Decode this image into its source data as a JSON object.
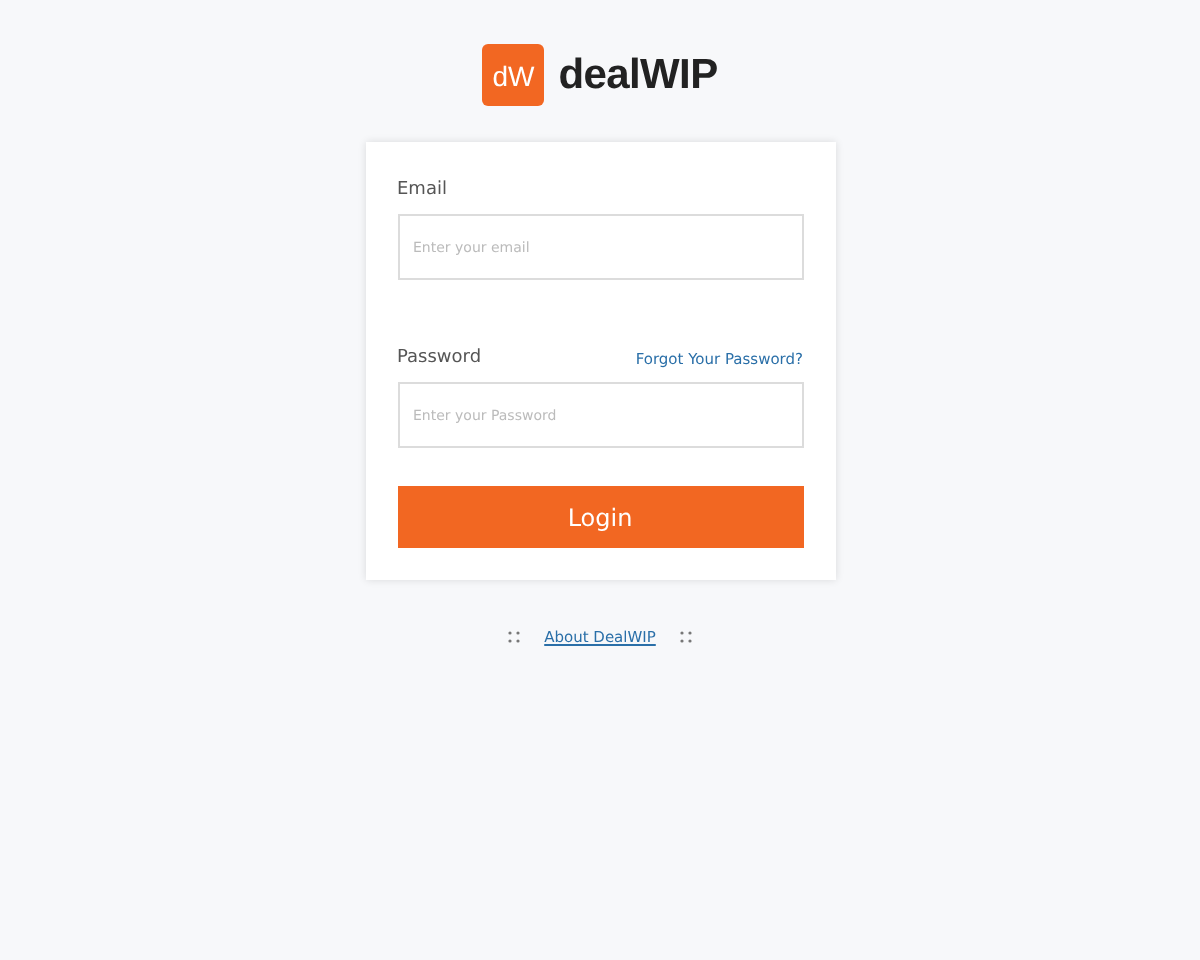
{
  "logo": {
    "mark": "dW",
    "name": "dealWIP"
  },
  "form": {
    "email": {
      "label": "Email",
      "placeholder": "Enter your email"
    },
    "password": {
      "label": "Password",
      "placeholder": "Enter your Password",
      "forgot_link": "Forgot Your Password?"
    },
    "submit": "Login"
  },
  "footer": {
    "link": "About DealWIP"
  }
}
